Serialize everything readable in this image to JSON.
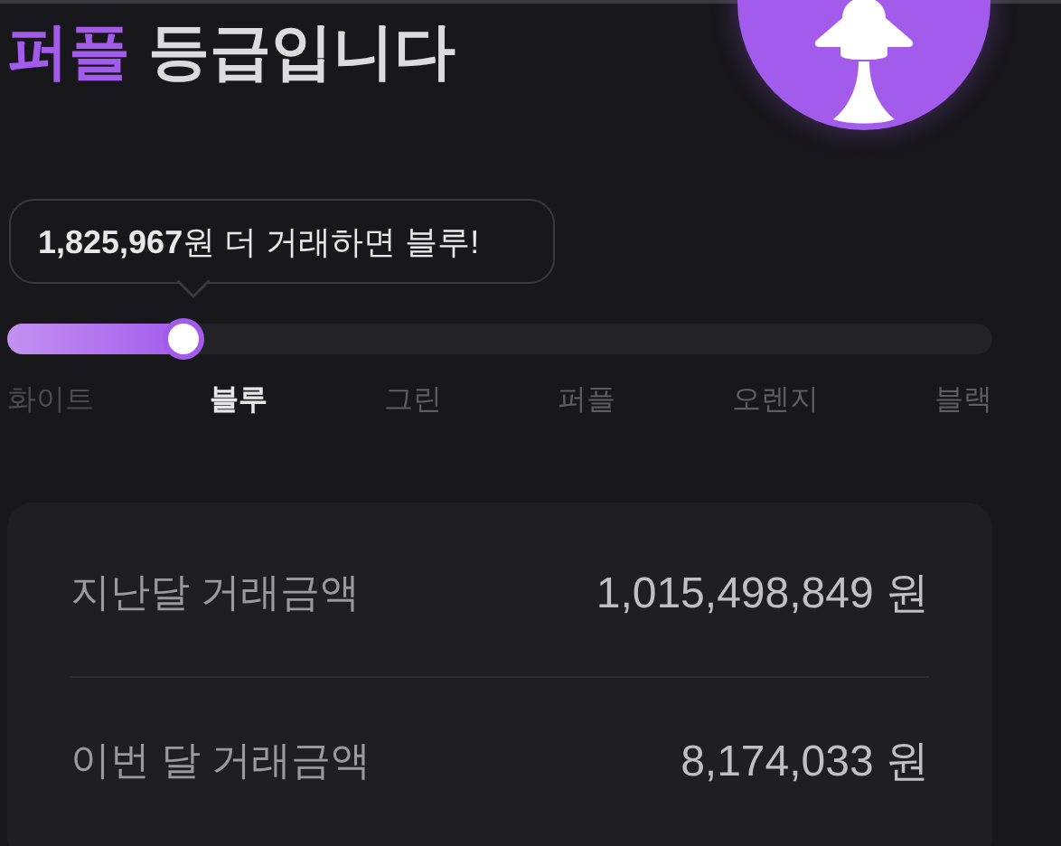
{
  "header": {
    "grade_name": "퍼플",
    "title_suffix": "등급입니다"
  },
  "tooltip": {
    "amount": "1,825,967",
    "text": "원 더 거래하면 블루!"
  },
  "progress": {
    "level": 0.18
  },
  "tiers": [
    {
      "label": "화이트",
      "selected": false,
      "passed": true
    },
    {
      "label": "블루",
      "selected": true,
      "passed": false
    },
    {
      "label": "그린",
      "selected": false,
      "passed": false
    },
    {
      "label": "퍼플",
      "selected": false,
      "passed": false
    },
    {
      "label": "오렌지",
      "selected": false,
      "passed": false
    },
    {
      "label": "블랙",
      "selected": false,
      "passed": false
    }
  ],
  "stats": [
    {
      "label": "지난달 거래금액",
      "value": "1,015,498,849 원"
    },
    {
      "label": "이번 달 거래금액",
      "value": "8,174,033 원"
    }
  ]
}
